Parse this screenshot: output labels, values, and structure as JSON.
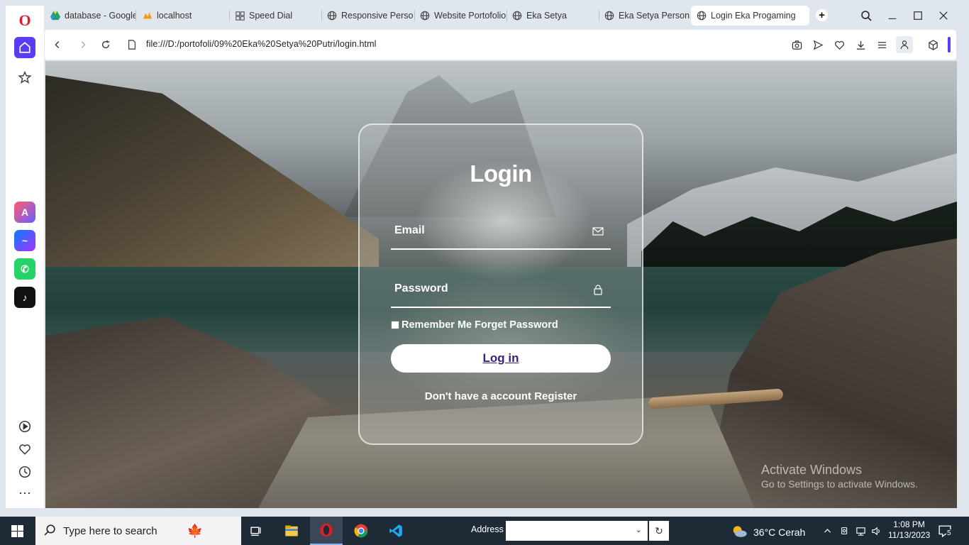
{
  "browser": {
    "tabs": [
      {
        "label": "database - Google",
        "icon": "google-drive-icon"
      },
      {
        "label": "localhost",
        "icon": "phpmyadmin-icon"
      },
      {
        "label": "Speed Dial",
        "icon": "speed-dial-icon"
      },
      {
        "label": "Responsive Person",
        "icon": "globe-icon"
      },
      {
        "label": "Website Portofolio",
        "icon": "globe-icon"
      },
      {
        "label": "Eka Setya",
        "icon": "globe-icon"
      },
      {
        "label": "Eka Setya Personal",
        "icon": "globe-icon"
      },
      {
        "label": "Login Eka Progaming",
        "icon": "globe-icon"
      }
    ],
    "url": "file:///D:/portofoli/09%20Eka%20Setya%20Putri/login.html",
    "new_tab_glyph": "+"
  },
  "page": {
    "login_title": "Login",
    "email_placeholder": "Email",
    "password_placeholder": "Password",
    "remember_label": "Remember Me Forget Password",
    "login_button": "Log in",
    "no_account_text": "Don't have a account",
    "register_link": "Register"
  },
  "watermark": {
    "line1": "Activate Windows",
    "line2": "Go to Settings to activate Windows."
  },
  "taskbar": {
    "search_placeholder": "Type here to search",
    "address_label": "Address",
    "weather": "36°C  Cerah",
    "time": "1:08 PM",
    "date": "11/13/2023",
    "notification_count": "5"
  }
}
